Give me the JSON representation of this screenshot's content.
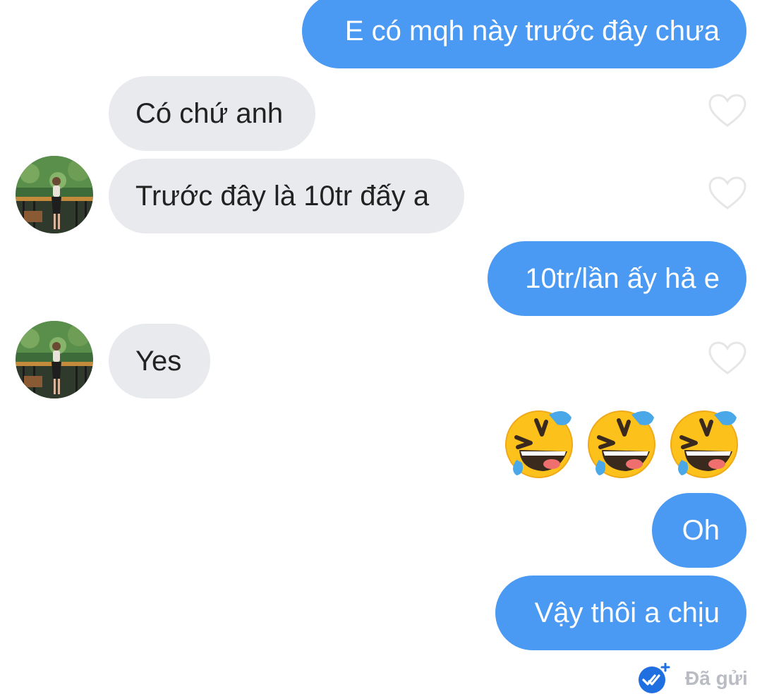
{
  "messages": [
    {
      "direction": "sent",
      "text": "E có mqh này trước đây chưa"
    },
    {
      "direction": "received",
      "text": "Có chứ anh",
      "liked": false
    },
    {
      "direction": "received",
      "text": "Trước đây là 10tr đấy a",
      "liked": false
    },
    {
      "direction": "sent",
      "text": "10tr/lần ấy hả e"
    },
    {
      "direction": "received",
      "text": "Yes",
      "liked": false
    },
    {
      "direction": "sent",
      "emojis": [
        "rolling-on-floor-laughing-emoji",
        "rolling-on-floor-laughing-emoji",
        "rolling-on-floor-laughing-emoji"
      ]
    },
    {
      "direction": "sent",
      "text": "Oh"
    },
    {
      "direction": "sent",
      "text": "Vậy thôi a chịu"
    }
  ],
  "status": {
    "icon": "sent-check-icon",
    "text": "Đã gửi"
  },
  "colors": {
    "sent_bubble": "#4a9af3",
    "received_bubble": "#e9eaee",
    "status_text": "#b9bcc3",
    "heart_outline": "#e6e6e6"
  }
}
